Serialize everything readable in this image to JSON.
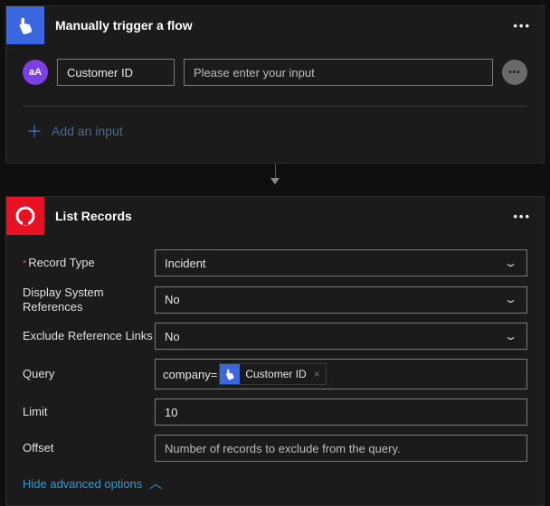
{
  "trigger": {
    "title": "Manually trigger a flow",
    "input_type_badge": "aA",
    "input_name": "Customer ID",
    "input_placeholder": "Please enter your input",
    "add_input_label": "Add an input"
  },
  "action": {
    "title": "List Records",
    "fields": {
      "record_type": {
        "label": "Record Type",
        "value": "Incident",
        "required": true
      },
      "display_system_refs": {
        "label": "Display System References",
        "value": "No"
      },
      "exclude_ref_links": {
        "label": "Exclude Reference Links",
        "value": "No"
      },
      "query": {
        "label": "Query",
        "prefix": "company=",
        "token_label": "Customer ID"
      },
      "limit": {
        "label": "Limit",
        "value": "10"
      },
      "offset": {
        "label": "Offset",
        "placeholder": "Number of records to exclude from the query."
      }
    },
    "hide_advanced_label": "Hide advanced options"
  }
}
